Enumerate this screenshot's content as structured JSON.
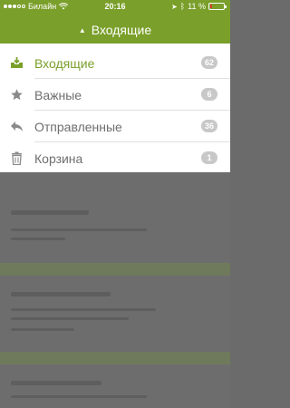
{
  "status_bar": {
    "carrier": "Билайн",
    "time": "20:16",
    "battery": "11 %",
    "battery_level": 0.11
  },
  "header": {
    "title": "Входящие"
  },
  "menu": {
    "items": [
      {
        "label": "Входящие",
        "count": "62",
        "icon": "inbox-icon",
        "active": true
      },
      {
        "label": "Важные",
        "count": "6",
        "icon": "star-icon",
        "active": false
      },
      {
        "label": "Отправленные",
        "count": "36",
        "icon": "reply-icon",
        "active": false
      },
      {
        "label": "Корзина",
        "count": "1",
        "icon": "trash-icon",
        "active": false
      }
    ]
  },
  "colors": {
    "accent": "#7a9f2a",
    "badge": "#c8c8c8",
    "text": "#6e6e6e"
  }
}
